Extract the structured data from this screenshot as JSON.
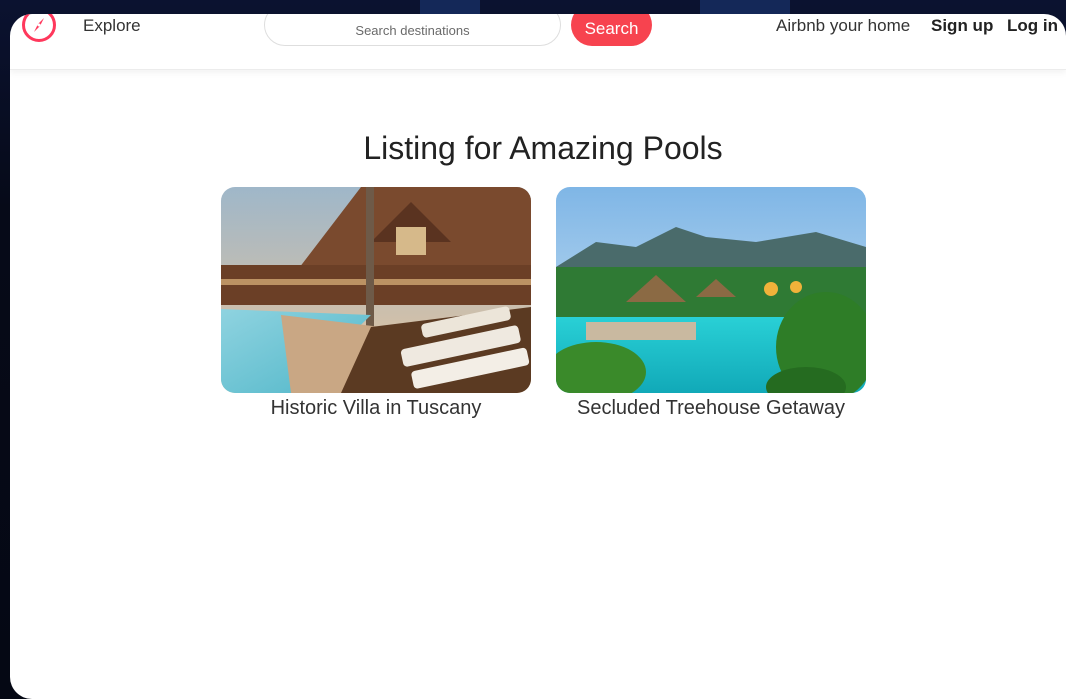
{
  "navbar": {
    "logo_icon": "compass-icon",
    "explore_label": "Explore",
    "search_placeholder": "Search destinations",
    "search_button_label": "Search",
    "host_link": "Airbnb your home",
    "signup_link": "Sign up",
    "login_link": "Log in"
  },
  "colors": {
    "accent": "#f7434f",
    "logo": "#ff385c",
    "text": "#222222"
  },
  "main": {
    "title": "Listing for Amazing Pools",
    "listings": [
      {
        "title": "Historic Villa in Tuscany",
        "image": "villa-pool-photo"
      },
      {
        "title": "Secluded Treehouse Getaway",
        "image": "tropical-pool-photo"
      }
    ]
  }
}
